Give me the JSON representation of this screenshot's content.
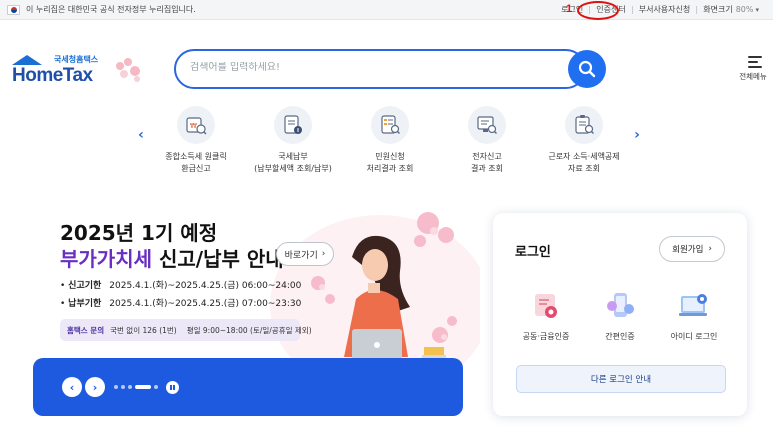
{
  "topbar": {
    "notice": "이 누리집은 대한민국 공식 전자정부 누리집입니다.",
    "links": [
      "로그인",
      "인증센터",
      "부서사용자신청"
    ],
    "zoom_label": "화면크기",
    "zoom_value": "80%",
    "annotation_number": "1"
  },
  "header": {
    "logo_sub": "국세청홈택스",
    "logo_main": "HomeTax",
    "search_placeholder": "검색어를 입력하세요!",
    "menu_label": "전체메뉴"
  },
  "quick_services": [
    {
      "label": "종합소득세 원클릭\n환급신고",
      "icon": "tax-refund-icon"
    },
    {
      "label": "국세납부\n(납부할세액 조회/납부)",
      "icon": "tax-payment-icon"
    },
    {
      "label": "민원신청\n처리결과 조회",
      "icon": "civil-petition-icon"
    },
    {
      "label": "전자신고\n결과 조회",
      "icon": "e-filing-result-icon"
    },
    {
      "label": "근로자 소득·세액공제\n자료 조회",
      "icon": "deduction-data-icon"
    }
  ],
  "banner": {
    "title_line1": "2025년 1기 예정",
    "title_highlight": "부가가치세",
    "title_rest": " 신고/납부 안내",
    "more_label": "바로가기",
    "lines": [
      {
        "label": "신고기한",
        "value": "2025.4.1.(화)~2025.4.25.(금) 06:00~24:00"
      },
      {
        "label": "납부기한",
        "value": "2025.4.1.(화)~2025.4.25.(금) 07:00~23:30"
      }
    ],
    "contact_label": "홈택스 문의",
    "contact_phone": "국번 없이 126 (1번)",
    "contact_hours": "평일 9:00~18:00 (토/일/공휴일 제외)"
  },
  "login_card": {
    "title": "로그인",
    "join_label": "회원가입",
    "options": [
      {
        "label": "공동·금융인증",
        "icon": "certificate-icon"
      },
      {
        "label": "간편인증",
        "icon": "simple-auth-icon"
      },
      {
        "label": "아이디 로그인",
        "icon": "id-login-icon"
      }
    ],
    "other_label": "다른 로그인 안내"
  },
  "colors": {
    "brand_blue": "#1f6ff0",
    "highlight_purple": "#6a2fc2",
    "annotation_red": "#e01010"
  }
}
